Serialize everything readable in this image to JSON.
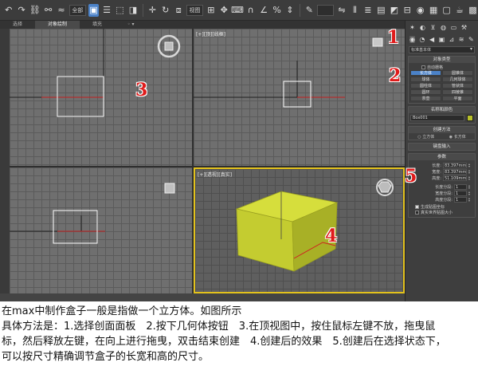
{
  "ribbon": {
    "tabs": [
      "选择",
      "对象绘制",
      "填充"
    ]
  },
  "viewports": {
    "top_label": "[+][顶][线框]",
    "perspective_label": "[+][透视][真实]"
  },
  "command_panel": {
    "category_select": "标准基本体",
    "object_type": {
      "header": "对象类型",
      "autogrid": "自动栅格",
      "buttons": [
        "长方体",
        "圆锥体",
        "球体",
        "几何球体",
        "圆柱体",
        "管状体",
        "圆环",
        "四棱锥",
        "茶壶",
        "平面"
      ]
    },
    "name_color": {
      "header": "名称和颜色",
      "name": "Box001",
      "color": "#b8c02a"
    },
    "creation_method": {
      "header": "创建方法",
      "options": [
        "立方体",
        "长方体"
      ]
    },
    "keyboard_entry": {
      "header": "键盘输入"
    },
    "parameters": {
      "header": "参数",
      "length_label": "长度:",
      "length_value": "83.397mm",
      "width_label": "宽度:",
      "width_value": "83.397mm",
      "height_label": "高度:",
      "height_value": "51.109mm",
      "length_segs_label": "长度分段:",
      "length_segs_value": "1",
      "width_segs_label": "宽度分段:",
      "width_segs_value": "1",
      "height_segs_label": "高度分段:",
      "height_segs_value": "1",
      "gen_mapping": "生成贴图坐标",
      "real_world": "真实世界贴图大小"
    }
  },
  "markers": [
    "1",
    "2",
    "3",
    "4",
    "5"
  ],
  "caption": {
    "line1": "在max中制作盒子一般是指做一个立方体。如图所示",
    "line2": "具体方法是：1.选择创面面板　2.按下几何体按钮　3.在顶视图中，按住鼠标左键不放，拖曳鼠",
    "line3": "标，然后释放左键，在向上进行拖曳，双击结束创建　4.创建后的效果　5.创建后在选择状态下，",
    "line4": "可以按尺寸精确调节盒子的长宽和高的尺寸。"
  },
  "colors": {
    "box_face": "#c9d233",
    "selection_red": "#e01b1b"
  }
}
